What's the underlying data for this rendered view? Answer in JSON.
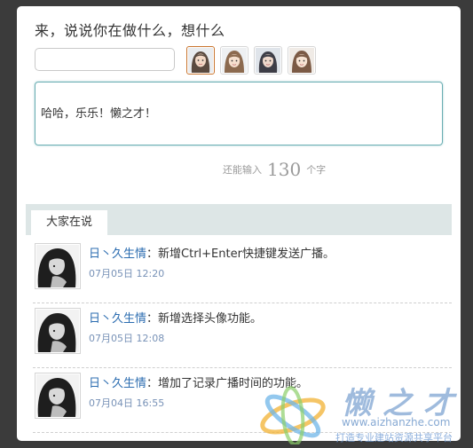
{
  "composer": {
    "prompt": "来，说说你在做什么，想什么",
    "name_value": "",
    "message_value": "哈哈，乐乐！懒之才！",
    "counter_prefix": "还能输入",
    "counter_value": "130",
    "counter_suffix": "个字",
    "avatars": [
      {
        "icon": "avatar-girl-icon",
        "selected": true
      },
      {
        "icon": "avatar-girl-icon",
        "selected": false
      },
      {
        "icon": "avatar-girl-icon",
        "selected": false
      },
      {
        "icon": "avatar-girl-icon",
        "selected": false
      }
    ]
  },
  "feed": {
    "tab_label": "大家在说",
    "items": [
      {
        "user": "日丶久生情",
        "sep": "：",
        "text": "新增Ctrl+Enter快捷键发送广播。",
        "time": "07月05日 12:20"
      },
      {
        "user": "日丶久生情",
        "sep": "：",
        "text": "新增选择头像功能。",
        "time": "07月05日 12:08"
      },
      {
        "user": "日丶久生情",
        "sep": "：",
        "text": "增加了记录广播时间的功能。",
        "time": "07月04日 16:55"
      }
    ]
  },
  "watermark": {
    "brand": "懒之才",
    "url": "www.aizhanzhe.com",
    "slogan": "打造专业建站资源共享平台"
  },
  "colors": {
    "page_background": "#3b3b3b",
    "input_focus_border": "#6aaeb3",
    "tab_bar": "#dde6e6",
    "username": "#2b6cb0",
    "timestamp": "#7892b7"
  }
}
